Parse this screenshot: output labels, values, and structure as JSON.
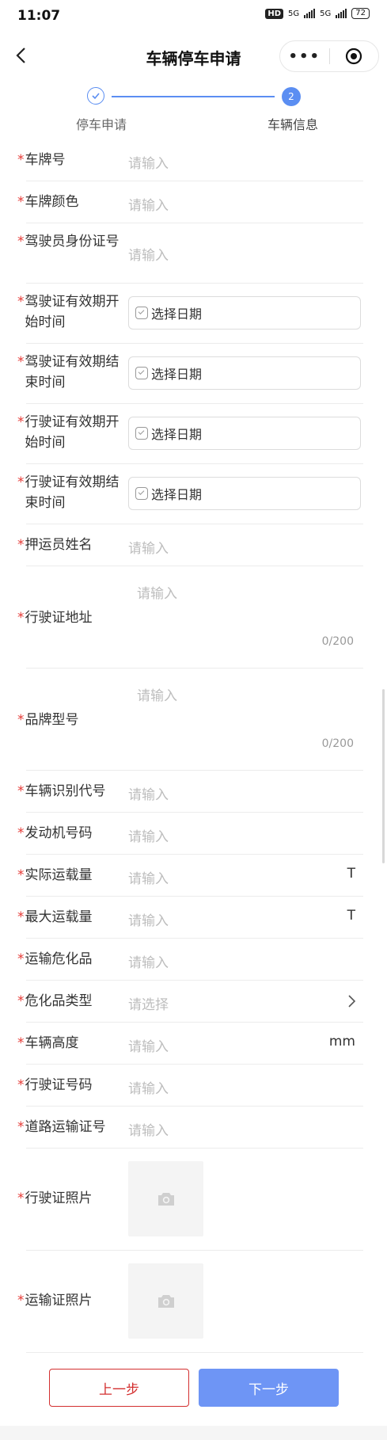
{
  "status_bar": {
    "time": "11:07",
    "hd": "HD",
    "sig1": "5G",
    "sig2": "5G",
    "battery": "72"
  },
  "nav": {
    "title": "车辆停车申请",
    "more": "•••"
  },
  "steps": [
    {
      "label": "停车申请",
      "state": "done"
    },
    {
      "label": "车辆信息",
      "number": "2",
      "state": "active"
    }
  ],
  "form": {
    "required_mark": "*",
    "plate_no": {
      "label": "车牌号",
      "placeholder": "请输入"
    },
    "plate_color": {
      "label": "车牌颜色",
      "placeholder": "请输入"
    },
    "driver_id": {
      "label": "驾驶员身份证号",
      "placeholder": "请输入"
    },
    "license_start": {
      "label": "驾驶证有效期开始时间",
      "value": "选择日期"
    },
    "license_end": {
      "label": "驾驶证有效期结束时间",
      "value": "选择日期"
    },
    "vehicle_lic_start": {
      "label": "行驶证有效期开始时间",
      "value": "选择日期"
    },
    "vehicle_lic_end": {
      "label": "行驶证有效期结束时间",
      "value": "选择日期"
    },
    "escort_name": {
      "label": "押运员姓名",
      "placeholder": "请输入"
    },
    "vehicle_lic_address": {
      "label": "行驶证地址",
      "placeholder": "请输入",
      "counter": "0/200"
    },
    "brand_model": {
      "label": "品牌型号",
      "placeholder": "请输入",
      "counter": "0/200"
    },
    "vin": {
      "label": "车辆识别代号",
      "placeholder": "请输入"
    },
    "engine_no": {
      "label": "发动机号码",
      "placeholder": "请输入"
    },
    "actual_load": {
      "label": "实际运载量",
      "placeholder": "请输入",
      "unit": "T"
    },
    "max_load": {
      "label": "最大运载量",
      "placeholder": "请输入",
      "unit": "T"
    },
    "hazmat": {
      "label": "运输危化品",
      "placeholder": "请输入"
    },
    "hazmat_type": {
      "label": "危化品类型",
      "placeholder": "请选择"
    },
    "height": {
      "label": "车辆高度",
      "placeholder": "请输入",
      "unit": "mm"
    },
    "vehicle_lic_no": {
      "label": "行驶证号码",
      "placeholder": "请输入"
    },
    "road_transport_no": {
      "label": "道路运输证号",
      "placeholder": "请输入"
    },
    "vehicle_lic_photo": {
      "label": "行驶证照片"
    },
    "transport_photo": {
      "label": "运输证照片"
    }
  },
  "buttons": {
    "prev": "上一步",
    "next": "下一步"
  },
  "colors": {
    "accent": "#5b8ef2",
    "required": "#e53935",
    "danger": "#d32f2f",
    "primary_button": "#6e95f5"
  }
}
